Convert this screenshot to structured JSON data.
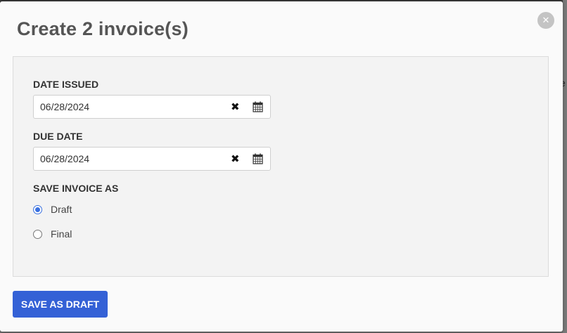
{
  "modal": {
    "title": "Create 2 invoice(s)",
    "close_icon": "close-icon"
  },
  "form": {
    "date_issued": {
      "label": "DATE ISSUED",
      "value": "06/28/2024",
      "clear_glyph": "✖",
      "calendar_icon": "calendar-icon"
    },
    "due_date": {
      "label": "DUE DATE",
      "value": "06/28/2024",
      "clear_glyph": "✖",
      "calendar_icon": "calendar-icon"
    },
    "save_invoice_as": {
      "label": "SAVE INVOICE AS",
      "options": [
        {
          "label": "Draft",
          "selected": true
        },
        {
          "label": "Final",
          "selected": false
        }
      ]
    }
  },
  "footer": {
    "save_button_label": "SAVE AS DRAFT"
  },
  "background": {
    "edge_letter": "e"
  },
  "colors": {
    "accent": "#3461d6",
    "radio_checked": "#3a71e0",
    "panel_bg": "#f3f3f3"
  }
}
